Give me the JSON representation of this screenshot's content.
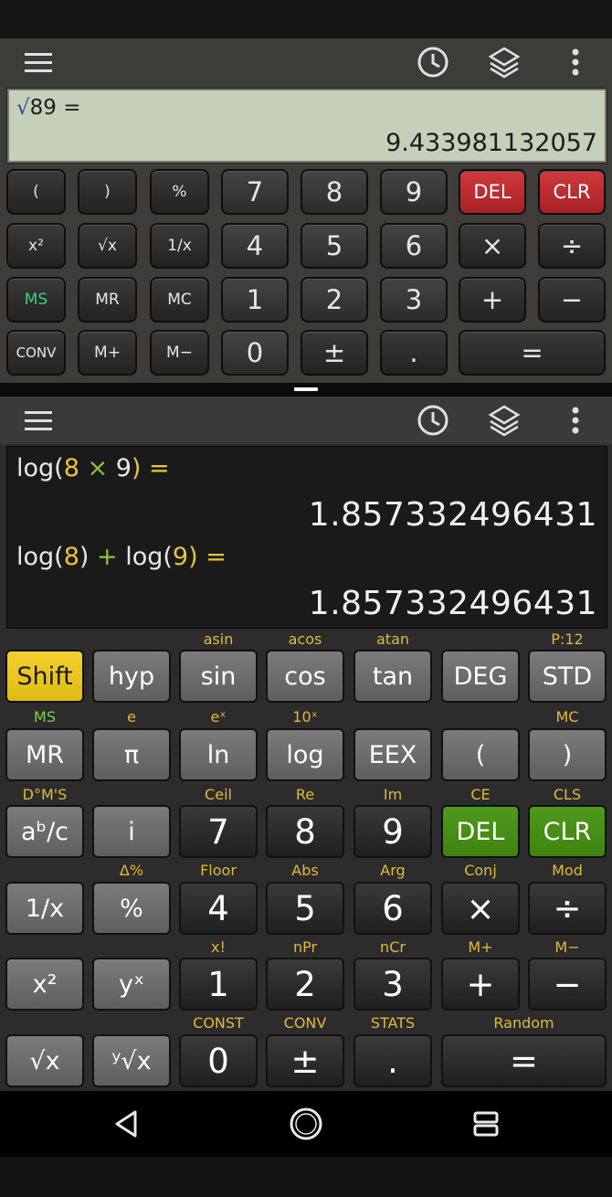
{
  "top_calc": {
    "display": {
      "expression_symbol": "√",
      "expression_rest": "89 =",
      "result": "9.433981132057"
    },
    "rows": [
      [
        "(",
        ")",
        "%",
        "7",
        "8",
        "9",
        "DEL",
        "CLR"
      ],
      [
        "x²",
        "√x",
        "1/x",
        "4",
        "5",
        "6",
        "×",
        "÷"
      ],
      [
        "MS",
        "MR",
        "MC",
        "1",
        "2",
        "3",
        "+",
        "−"
      ],
      [
        "CONV",
        "M+",
        "M−",
        "0",
        "±",
        ".",
        "="
      ]
    ]
  },
  "bottom_calc": {
    "display": {
      "line1": {
        "fn": "log(",
        "a": "8",
        "op": " × ",
        "b": "9",
        "close": ") =",
        "result": "1.857332496431"
      },
      "line2": {
        "fn1": "log(",
        "a": "8",
        "mid": ") ",
        "op": "+",
        "fn2": " log(",
        "b": "9",
        "close": ") =",
        "result": "1.857332496431"
      }
    },
    "row1": {
      "labels": [
        "",
        "",
        "asin",
        "acos",
        "atan",
        "",
        "P:12"
      ],
      "keys": [
        "Shift",
        "hyp",
        "sin",
        "cos",
        "tan",
        "DEG",
        "STD"
      ]
    },
    "row2": {
      "labels": [
        "MS",
        "e",
        "eˣ",
        "10ˣ",
        "",
        "",
        "MC"
      ],
      "keys": [
        "MR",
        "π",
        "ln",
        "log",
        "EEX",
        "(",
        ")"
      ]
    },
    "row3": {
      "labels": [
        "D°M'S",
        "",
        "Ceil",
        "Re",
        "Im",
        "CE",
        "CLS"
      ],
      "keys": [
        "aᵇ/c",
        "i",
        "7",
        "8",
        "9",
        "DEL",
        "CLR"
      ]
    },
    "row4": {
      "labels": [
        "",
        "Δ%",
        "Floor",
        "Abs",
        "Arg",
        "Conj",
        "Mod"
      ],
      "keys": [
        "1/x",
        "%",
        "4",
        "5",
        "6",
        "×",
        "÷"
      ]
    },
    "row5": {
      "labels": [
        "",
        "",
        "x!",
        "nPr",
        "nCr",
        "M+",
        "M−"
      ],
      "keys": [
        "x²",
        "yˣ",
        "1",
        "2",
        "3",
        "+",
        "−"
      ]
    },
    "row6": {
      "labels": [
        "",
        "",
        "CONST",
        "CONV",
        "STATS",
        "Random"
      ],
      "keys": [
        "√x",
        "ʸ√x",
        "0",
        "±",
        ".",
        "="
      ]
    }
  },
  "icons": [
    "menu-icon",
    "history-clock-icon",
    "layers-icon",
    "more-vert-icon",
    "nav-back-icon",
    "nav-home-icon",
    "nav-recents-icon"
  ],
  "colors": {
    "lcd": "#c6cfb8",
    "red_key": "#c22e30",
    "green_key": "#4a9418",
    "shift_yellow": "#f0cc25",
    "second_fn_label": "#e2b93a"
  }
}
